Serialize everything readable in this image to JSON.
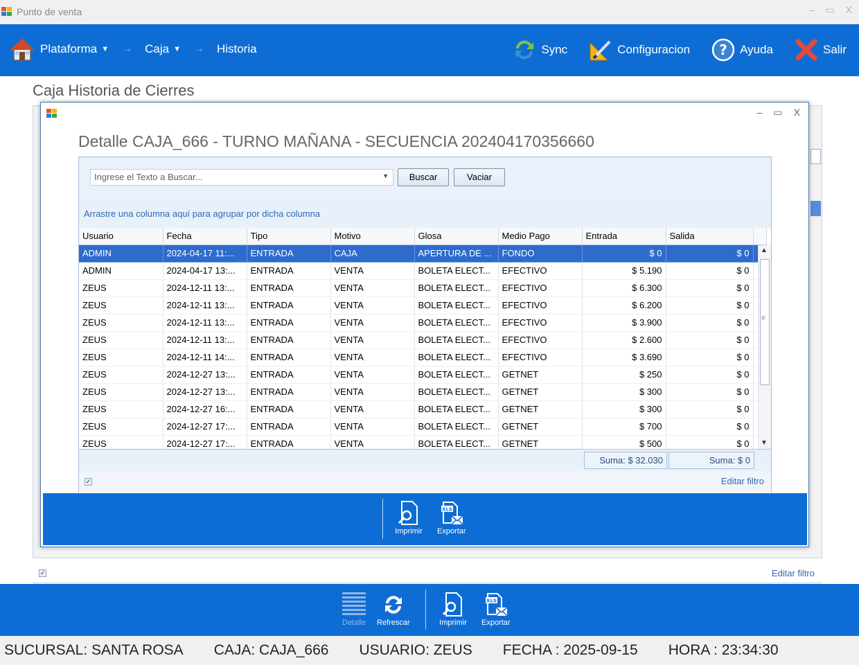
{
  "window": {
    "title": "Punto de venta",
    "controls": [
      "–",
      "▭",
      "X"
    ]
  },
  "nav": {
    "items": [
      {
        "label": "Plataforma",
        "has_dropdown": true
      },
      {
        "label": "Caja",
        "has_dropdown": true
      },
      {
        "label": "Historia",
        "has_dropdown": false
      }
    ],
    "actions": [
      {
        "label": "Sync",
        "icon": "sync-icon"
      },
      {
        "label": "Configuracion",
        "icon": "settings-icon"
      },
      {
        "label": "Ayuda",
        "icon": "help-icon"
      },
      {
        "label": "Salir",
        "icon": "exit-icon"
      }
    ]
  },
  "page": {
    "title": "Caja Historia de Cierres",
    "edit_filter": "Editar filtro"
  },
  "dialog": {
    "heading": "Detalle CAJA_666 - TURNO MAÑANA - SECUENCIA 202404170356660",
    "controls": [
      "–",
      "▭",
      "X"
    ],
    "search": {
      "placeholder": "Ingrese el Texto a Buscar...",
      "buscar": "Buscar",
      "vaciar": "Vaciar"
    },
    "group_hint": "Arrastre una columna aquí para agrupar por dicha columna",
    "columns": [
      "Usuario",
      "Fecha",
      "Tipo",
      "Motivo",
      "Glosa",
      "Medio Pago",
      "Entrada",
      "Salida"
    ],
    "rows": [
      [
        "ADMIN",
        "2024-04-17 11:...",
        "ENTRADA",
        "CAJA",
        "APERTURA DE ...",
        "FONDO",
        "$ 0",
        "$ 0"
      ],
      [
        "ADMIN",
        "2024-04-17 13:...",
        "ENTRADA",
        "VENTA",
        "BOLETA ELECT...",
        "EFECTIVO",
        "$ 5.190",
        "$ 0"
      ],
      [
        "ZEUS",
        "2024-12-11 13:...",
        "ENTRADA",
        "VENTA",
        "BOLETA ELECT...",
        "EFECTIVO",
        "$ 6.300",
        "$ 0"
      ],
      [
        "ZEUS",
        "2024-12-11 13:...",
        "ENTRADA",
        "VENTA",
        "BOLETA ELECT...",
        "EFECTIVO",
        "$ 6.200",
        "$ 0"
      ],
      [
        "ZEUS",
        "2024-12-11 13:...",
        "ENTRADA",
        "VENTA",
        "BOLETA ELECT...",
        "EFECTIVO",
        "$ 3.900",
        "$ 0"
      ],
      [
        "ZEUS",
        "2024-12-11 13:...",
        "ENTRADA",
        "VENTA",
        "BOLETA ELECT...",
        "EFECTIVO",
        "$ 2.600",
        "$ 0"
      ],
      [
        "ZEUS",
        "2024-12-11 14:...",
        "ENTRADA",
        "VENTA",
        "BOLETA ELECT...",
        "EFECTIVO",
        "$ 3.690",
        "$ 0"
      ],
      [
        "ZEUS",
        "2024-12-27 13:...",
        "ENTRADA",
        "VENTA",
        "BOLETA ELECT...",
        "GETNET",
        "$ 250",
        "$ 0"
      ],
      [
        "ZEUS",
        "2024-12-27 13:...",
        "ENTRADA",
        "VENTA",
        "BOLETA ELECT...",
        "GETNET",
        "$ 300",
        "$ 0"
      ],
      [
        "ZEUS",
        "2024-12-27 16:...",
        "ENTRADA",
        "VENTA",
        "BOLETA ELECT...",
        "GETNET",
        "$ 300",
        "$ 0"
      ],
      [
        "ZEUS",
        "2024-12-27 17:...",
        "ENTRADA",
        "VENTA",
        "BOLETA ELECT...",
        "GETNET",
        "$ 700",
        "$ 0"
      ],
      [
        "ZEUS",
        "2024-12-27 17:...",
        "ENTRADA",
        "VENTA",
        "BOLETA ELECT...",
        "GETNET",
        "$ 500",
        "$ 0"
      ]
    ],
    "selected_row": 0,
    "sum_entrada": "Suma: $ 32.030",
    "sum_salida": "Suma: $ 0",
    "edit_filter": "Editar filtro",
    "imprimir": "Imprimir",
    "exportar": "Exportar"
  },
  "bottom": {
    "detalle": "Detalle",
    "refrescar": "Refrescar",
    "imprimir": "Imprimir",
    "exportar": "Exportar"
  },
  "status": {
    "sucursal": "SUCURSAL: SANTA ROSA",
    "caja": "CAJA: CAJA_666",
    "usuario": "USUARIO: ZEUS",
    "fecha": "FECHA : 2025-09-15",
    "hora": "HORA : 23:34:30"
  },
  "colors": {
    "accent": "#0e6dd4",
    "selection": "#2d6bcd"
  }
}
